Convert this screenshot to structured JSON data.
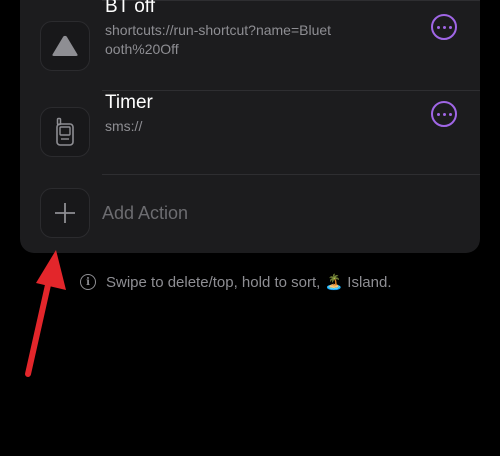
{
  "actions": [
    {
      "title": "BT off",
      "subtitle": "shortcuts://run-shortcut?name=Bluetooth%20Off",
      "icon": "triangle-icon"
    },
    {
      "title": "Timer",
      "subtitle": "sms://",
      "icon": "flip-phone-icon"
    }
  ],
  "add_action": {
    "label": "Add Action",
    "icon": "plus-icon"
  },
  "hint": {
    "icon": "info-icon",
    "text": "Swipe to delete/top, hold to sort, 🏝️ Island."
  },
  "colors": {
    "card_bg": "#1c1c1e",
    "accent_purple": "#a066e6",
    "annotation_red": "#e3262b",
    "secondary_text": "#8e8e93"
  }
}
